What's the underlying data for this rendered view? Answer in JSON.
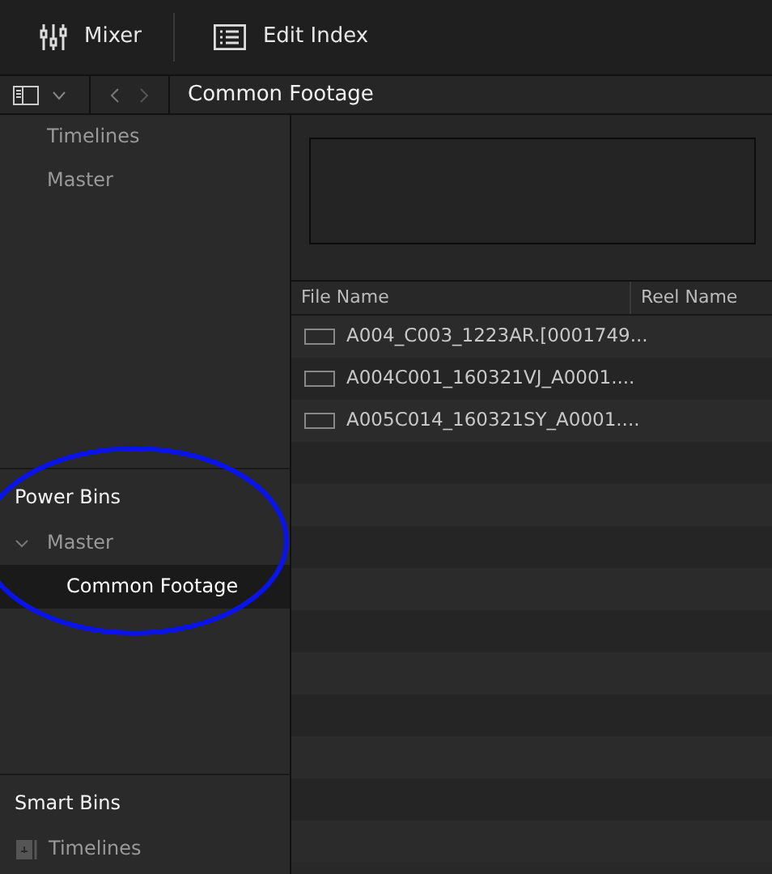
{
  "toolbar": [
    {
      "label": "Mixer",
      "kind": "mixer"
    },
    {
      "label": "Edit Index",
      "kind": "index"
    }
  ],
  "path_bar": {
    "title": "Common Footage"
  },
  "bins": [
    {
      "label": "Timelines"
    },
    {
      "label": "Master"
    }
  ],
  "power_bins": {
    "title": "Power Bins",
    "items": [
      {
        "label": "Master",
        "expanded": true,
        "children": [
          {
            "label": "Common Footage",
            "selected": true
          }
        ]
      }
    ]
  },
  "smart_bins": {
    "title": "Smart Bins",
    "items": [
      {
        "label": "Timelines"
      }
    ]
  },
  "table": {
    "columns": [
      "File Name",
      "Reel Name"
    ],
    "rows": [
      {
        "file_name": "A004_C003_1223AR.[0001749..."
      },
      {
        "file_name": "A004C001_160321VJ_A0001...."
      },
      {
        "file_name": "A005C014_160321SY_A0001...."
      }
    ]
  }
}
